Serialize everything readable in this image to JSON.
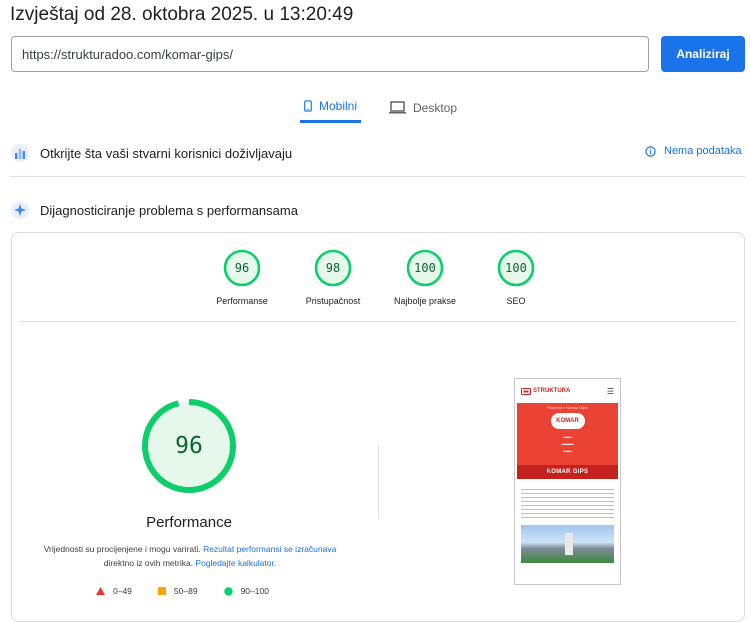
{
  "report_title": "Izvještaj od 28. oktobra 2025. u 13:20:49",
  "url_input": {
    "value": "https://strukturadoo.com/komar-gips/"
  },
  "analyze_button": "Analiziraj",
  "tabs": [
    {
      "label": "Mobilni",
      "icon": "smartphone-icon",
      "active": true
    },
    {
      "label": "Desktop",
      "icon": "laptop-icon",
      "active": false
    }
  ],
  "field_data": {
    "heading": "Otkrijte šta vaši stvarni korisnici doživljavaju",
    "icon": "users-chart-icon",
    "status": "Nema podataka",
    "status_icon": "info-icon"
  },
  "diagnostics": {
    "heading": "Dijagnosticiranje problema s performansama",
    "icon": "lab-flask-icon"
  },
  "scores": [
    {
      "label": "Performanse",
      "value": "96"
    },
    {
      "label": "Pristupačnost",
      "value": "98"
    },
    {
      "label": "Najbolje prakse",
      "value": "100"
    },
    {
      "label": "SEO",
      "value": "100"
    }
  ],
  "performance": {
    "score": "96",
    "title": "Performance",
    "note_prefix": "Vrijednosti su procijenjene i mogu varirati. ",
    "note_link1": "Rezultat performansi se izračunava",
    "note_middle": " direktno iz ovih metrika. ",
    "note_link2": "Pogledajte kalkulator."
  },
  "legend": [
    {
      "range": "0–49",
      "color": "#e53935",
      "shape": "triangle-icon"
    },
    {
      "range": "50–89",
      "color": "#ffa400",
      "shape": "square-icon"
    },
    {
      "range": "90–100",
      "color": "#0cce6b",
      "shape": "circle-icon"
    }
  ],
  "preview": {
    "brand": "STRUKTURA",
    "breadcrumb": "Početna » Komar Gips",
    "logo_text": "KOMAR",
    "banner": "KOMAR GIPS"
  },
  "colors": {
    "accent": "#1a73e8",
    "pass": "#0cce6b",
    "pass_text": "#0d652d"
  }
}
